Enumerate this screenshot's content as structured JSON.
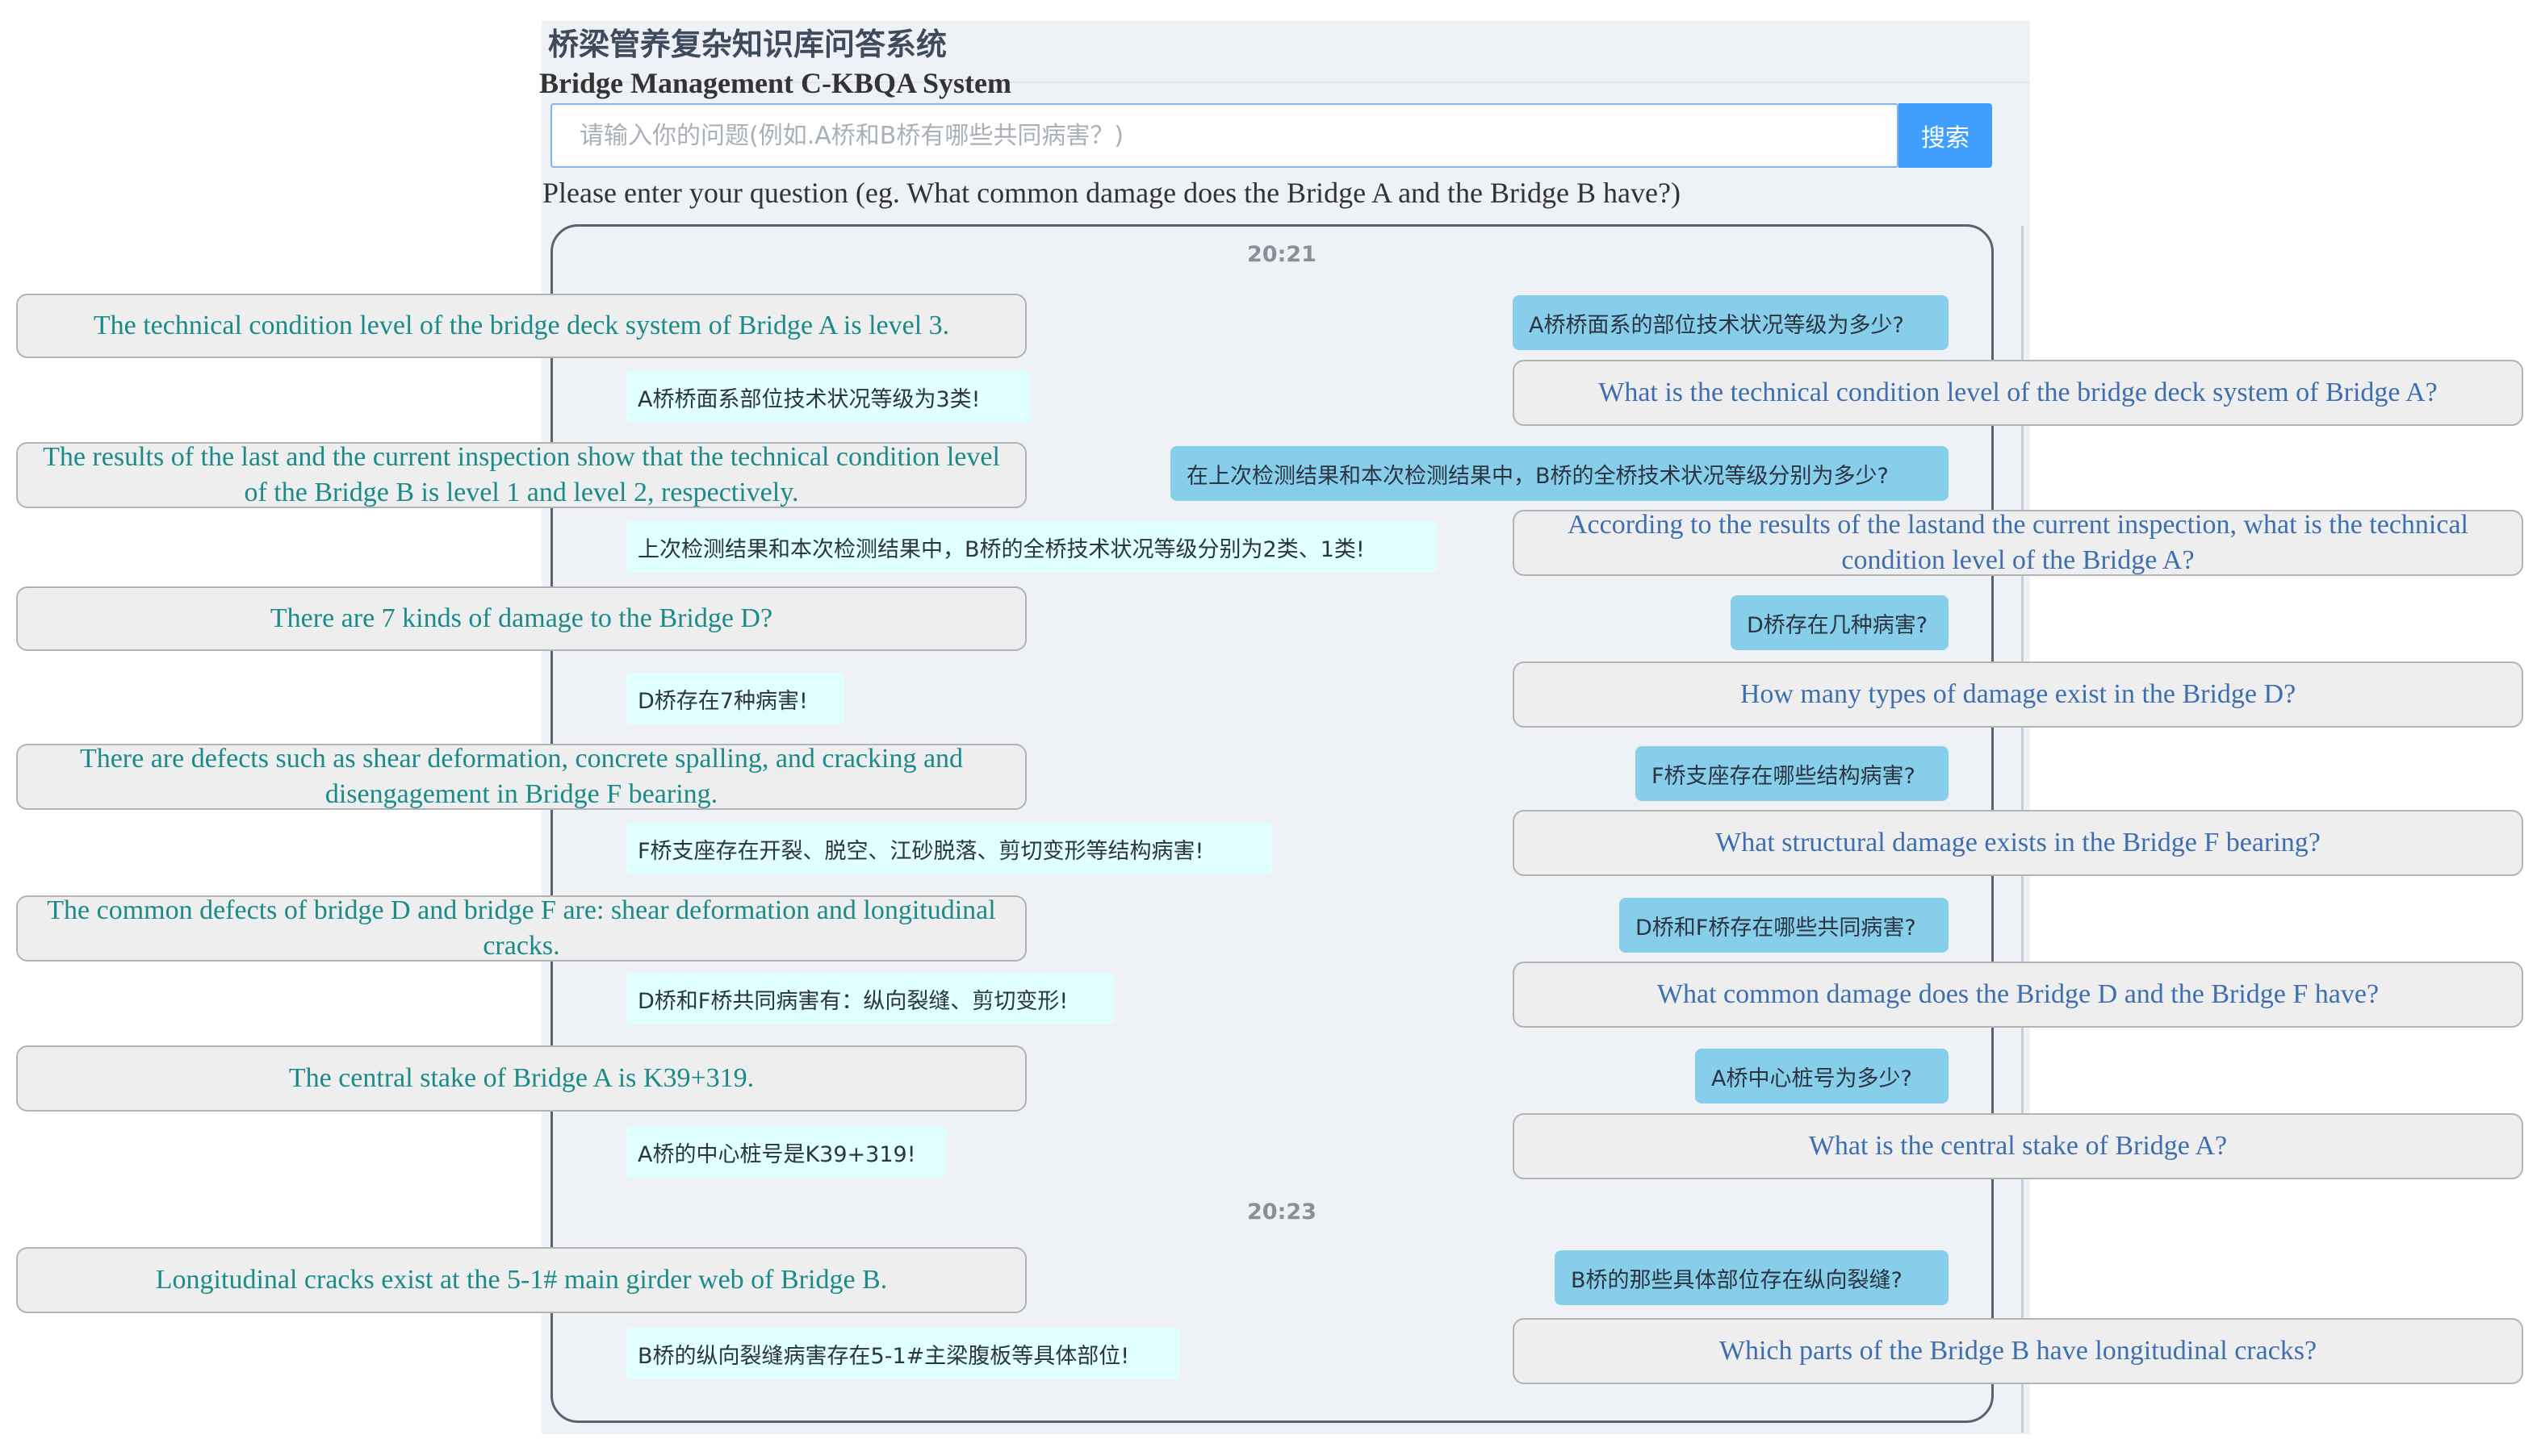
{
  "app": {
    "title": "桥梁管养复杂知识库问答系统",
    "subtitle": "Bridge Management C-KBQA System"
  },
  "search": {
    "placeholder": "请输入你的问题(例如.A桥和B桥有哪些共同病害？)",
    "button_label": "搜索",
    "caption": "Please enter your question (eg. What common damage does the Bridge A and the Bridge B have?)"
  },
  "chat": {
    "timestamps": [
      "20:21",
      "20:23"
    ],
    "exchanges": [
      {
        "question": "A桥桥面系的部位技术状况等级为多少?",
        "question_en": "What is the technical condition level of the bridge deck system of Bridge A?",
        "answer": "A桥桥面系部位技术状况等级为3类!",
        "answer_en": "The technical condition level of the bridge deck system of Bridge A is level 3."
      },
      {
        "question": "在上次检测结果和本次检测结果中，B桥的全桥技术状况等级分别为多少?",
        "question_en": "According to the results of the lastand the current inspection, what is the technical condition level of the Bridge A?",
        "answer": "上次检测结果和本次检测结果中，B桥的全桥技术状况等级分别为2类、1类!",
        "answer_en": "The results of the last and the current inspection show that the technical condition level of the Bridge B is level 1 and level 2, respectively."
      },
      {
        "question": "D桥存在几种病害?",
        "question_en": "How many types of damage exist in the Bridge D?",
        "answer": "D桥存在7种病害!",
        "answer_en": "There are 7 kinds of damage to the Bridge D?"
      },
      {
        "question": "F桥支座存在哪些结构病害?",
        "question_en": "What structural damage exists in the Bridge F bearing?",
        "answer": "F桥支座存在开裂、脱空、江砂脱落、剪切变形等结构病害!",
        "answer_en": "There are defects such as shear deformation, concrete spalling, and cracking and disengagement in Bridge F bearing."
      },
      {
        "question": "D桥和F桥存在哪些共同病害?",
        "question_en": "What common damage does the Bridge D and the Bridge F have?",
        "answer": "D桥和F桥共同病害有：纵向裂缝、剪切变形!",
        "answer_en": "The common defects of bridge D and bridge F are: shear deformation and longitudinal cracks."
      },
      {
        "question": "A桥中心桩号为多少?",
        "question_en": "What is the central stake of Bridge A?",
        "answer": "A桥的中心桩号是K39+319!",
        "answer_en": "The central stake of Bridge A is K39+319."
      },
      {
        "question": "B桥的那些具体部位存在纵向裂缝?",
        "question_en": "Which parts of the Bridge B have longitudinal cracks?",
        "answer": "B桥的纵向裂缝病害存在5-1#主梁腹板等具体部位!",
        "answer_en": "Longitudinal cracks exist at the 5-1# main girder web of Bridge B."
      }
    ]
  }
}
